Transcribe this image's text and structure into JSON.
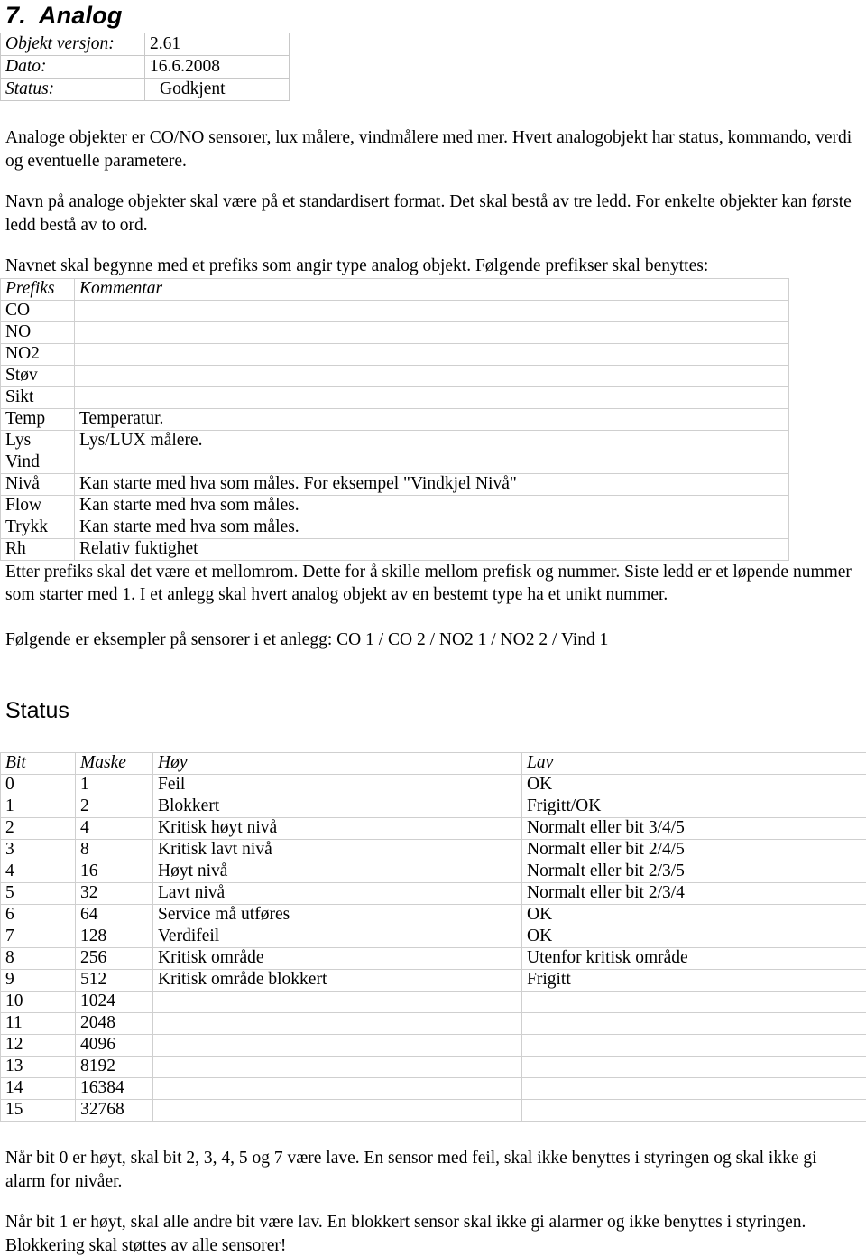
{
  "document": {
    "title_number": "7.",
    "title_text": "Analog"
  },
  "meta_table": {
    "rows": [
      {
        "label": "Objekt versjon:",
        "value": "2.61"
      },
      {
        "label": "Dato:",
        "value": "16.6.2008"
      },
      {
        "label": "Status:",
        "value": "Godkjent"
      }
    ]
  },
  "intro": {
    "p1": "Analoge objekter er CO/NO sensorer, lux målere, vindmålere med mer. Hvert analogobjekt har status, kommando, verdi og eventuelle parametere.",
    "p2": "Navn på analoge objekter skal være på et standardisert format. Det skal bestå av tre ledd. For enkelte objekter kan første ledd bestå av to ord.",
    "p3": "Navnet skal begynne med et prefiks som angir type analog objekt. Følgende prefikser skal benyttes:"
  },
  "prefix_table": {
    "headers": {
      "prefix": "Prefiks",
      "comment": "Kommentar"
    },
    "rows": [
      {
        "prefix": "CO",
        "comment": ""
      },
      {
        "prefix": "NO",
        "comment": ""
      },
      {
        "prefix": "NO2",
        "comment": ""
      },
      {
        "prefix": "Støv",
        "comment": ""
      },
      {
        "prefix": "Sikt",
        "comment": ""
      },
      {
        "prefix": "Temp",
        "comment": "Temperatur."
      },
      {
        "prefix": "Lys",
        "comment": "Lys/LUX målere."
      },
      {
        "prefix": "Vind",
        "comment": ""
      },
      {
        "prefix": "Nivå",
        "comment": "Kan starte med hva som måles. For eksempel \"Vindkjel Nivå\""
      },
      {
        "prefix": "Flow",
        "comment": "Kan starte med hva som måles."
      },
      {
        "prefix": "Trykk",
        "comment": "Kan starte med hva som måles."
      },
      {
        "prefix": "Rh",
        "comment": "Relativ fuktighet"
      }
    ]
  },
  "after_prefix": {
    "p1": "Etter prefiks skal det være et mellomrom. Dette for å skille mellom prefisk og nummer. Siste ledd er et løpende nummer som starter med 1. I et anlegg skal hvert analog objekt av en bestemt type ha et unikt nummer.",
    "p2": "Følgende er eksempler på sensorer i et anlegg: CO 1 / CO 2 / NO2 1 / NO2 2 / Vind 1"
  },
  "status_section": {
    "heading": "Status",
    "table": {
      "headers": {
        "bit": "Bit",
        "maske": "Maske",
        "hoy": "Høy",
        "lav": "Lav"
      },
      "rows": [
        {
          "bit": "0",
          "maske": "1",
          "hoy": "Feil",
          "lav": "OK"
        },
        {
          "bit": "1",
          "maske": "2",
          "hoy": "Blokkert",
          "lav": "Frigitt/OK"
        },
        {
          "bit": "2",
          "maske": "4",
          "hoy": "Kritisk høyt nivå",
          "lav": "Normalt eller bit 3/4/5"
        },
        {
          "bit": "3",
          "maske": "8",
          "hoy": "Kritisk lavt nivå",
          "lav": "Normalt eller bit 2/4/5"
        },
        {
          "bit": "4",
          "maske": "16",
          "hoy": "Høyt nivå",
          "lav": "Normalt eller bit 2/3/5"
        },
        {
          "bit": "5",
          "maske": "32",
          "hoy": "Lavt nivå",
          "lav": "Normalt eller bit 2/3/4"
        },
        {
          "bit": "6",
          "maske": "64",
          "hoy": "Service må utføres",
          "lav": "OK"
        },
        {
          "bit": "7",
          "maske": "128",
          "hoy": "Verdifeil",
          "lav": "OK"
        },
        {
          "bit": "8",
          "maske": "256",
          "hoy": "Kritisk område",
          "lav": "Utenfor kritisk område"
        },
        {
          "bit": "9",
          "maske": "512",
          "hoy": "Kritisk område blokkert",
          "lav": "Frigitt"
        },
        {
          "bit": "10",
          "maske": "1024",
          "hoy": "",
          "lav": ""
        },
        {
          "bit": "11",
          "maske": "2048",
          "hoy": "",
          "lav": ""
        },
        {
          "bit": "12",
          "maske": "4096",
          "hoy": "",
          "lav": ""
        },
        {
          "bit": "13",
          "maske": "8192",
          "hoy": "",
          "lav": ""
        },
        {
          "bit": "14",
          "maske": "16384",
          "hoy": "",
          "lav": ""
        },
        {
          "bit": "15",
          "maske": "32768",
          "hoy": "",
          "lav": ""
        }
      ]
    }
  },
  "footer_notes": {
    "p1": "Når bit 0 er høyt, skal bit 2, 3, 4, 5 og 7 være lave. En sensor med feil, skal ikke benyttes i styringen og skal ikke gi alarm for nivåer.",
    "p2": "Når bit 1 er høyt, skal alle andre bit være lav. En blokkert sensor skal ikke gi alarmer og ikke benyttes i styringen. Blokkering skal støttes av alle sensorer!"
  }
}
